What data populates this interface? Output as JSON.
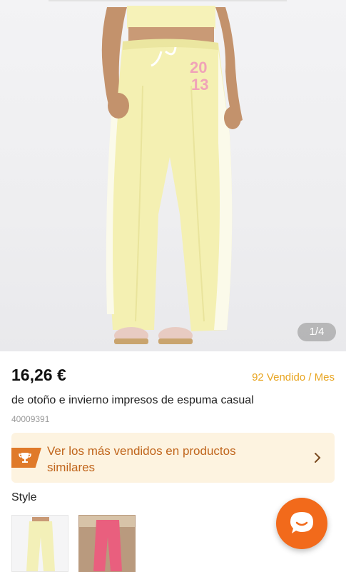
{
  "gallery": {
    "counter": "1/4",
    "graphic_text_line1": "20",
    "graphic_text_line2": "13"
  },
  "product": {
    "price": "16,26 €",
    "sold": "92 Vendido / Mes",
    "title": "de otoño e invierno impresos de espuma casual",
    "sku": "40009391"
  },
  "banner": {
    "text": "Ver los más vendidos en productos similares",
    "icon": "trophy-icon"
  },
  "style": {
    "label": "Style",
    "options": [
      {
        "color": "#f3f0b8"
      },
      {
        "color": "#e95f7e"
      }
    ]
  },
  "colors": {
    "accent": "#f26a1b",
    "sold_color": "#e8a521",
    "banner_bg": "#fdf3e0",
    "banner_text": "#c0651c"
  },
  "chat_button": {
    "icon": "chat-bubble-icon"
  }
}
